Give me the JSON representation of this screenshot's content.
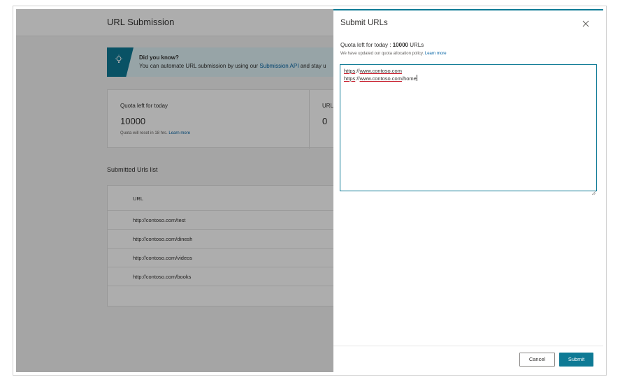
{
  "background": {
    "title": "URL Submission",
    "tip": {
      "title": "Did you know?",
      "text_prefix": "You can automate URL submission by using our ",
      "link": "Submission API",
      "text_suffix": " and stay u"
    },
    "quota_card": {
      "label": "Quota left for today",
      "value": "10000",
      "reset_text": "Quota will reset in 18 hrs. ",
      "reset_link": "Learn more",
      "col2_label": "URL",
      "col2_value": "0"
    },
    "list_title": "Submitted Urls list",
    "table": {
      "header": "URL",
      "rows": [
        "http://contoso.com/test",
        "http://contoso.com/dinesh",
        "http://contoso.com/videos",
        "http://contoso.com/books"
      ]
    }
  },
  "panel": {
    "title": "Submit URLs",
    "quota_prefix": "Quota left for today : ",
    "quota_value": "10000",
    "quota_suffix": " URLs",
    "policy_text": "We have updated our quota allocation policy. ",
    "policy_link": "Learn more",
    "input_lines": [
      {
        "scheme": "https",
        "sep": "://",
        "host": "www.contoso.com",
        "path": ""
      },
      {
        "scheme": "https",
        "sep": "://",
        "host": "www.contoso.com",
        "path": "/home"
      }
    ],
    "cancel_label": "Cancel",
    "submit_label": "Submit"
  },
  "icons": {
    "tip": "lightbulb-icon",
    "close": "close-icon"
  },
  "colors": {
    "accent": "#0e7a95",
    "link": "#0062a3"
  }
}
